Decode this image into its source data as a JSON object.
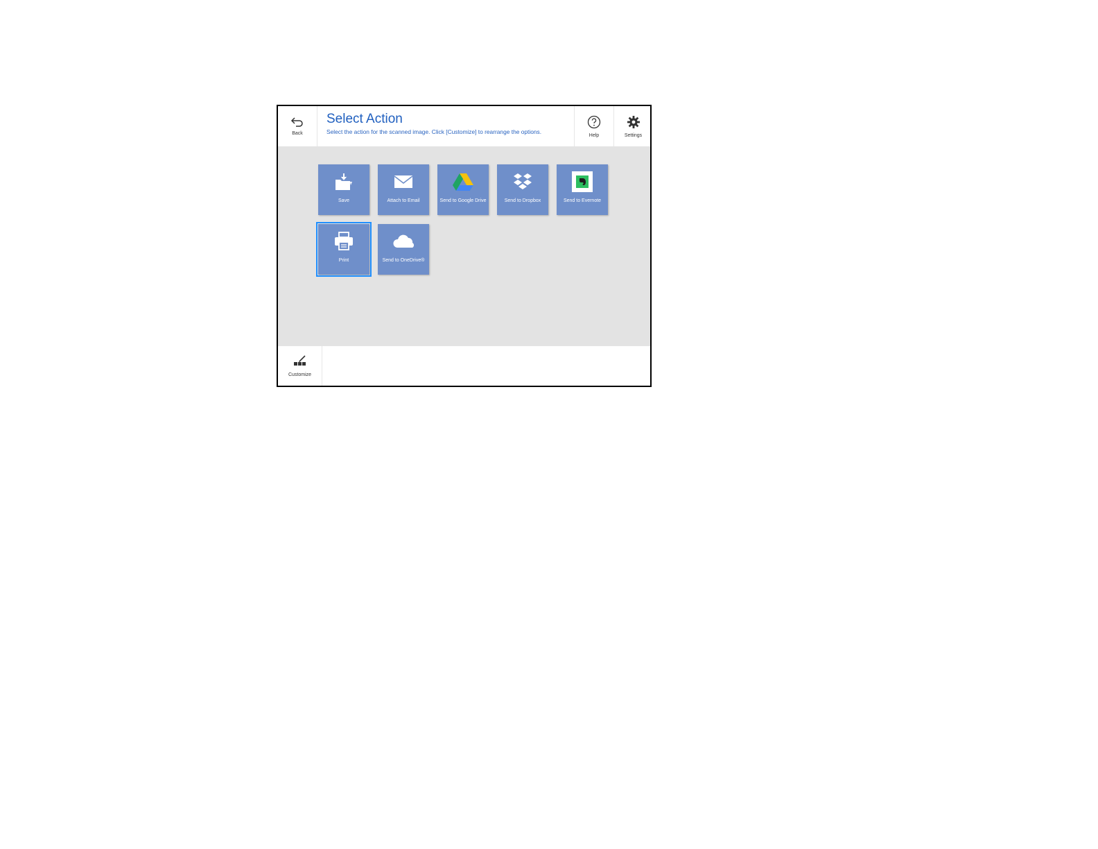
{
  "header": {
    "back_label": "Back",
    "title": "Select Action",
    "subtitle": "Select the action for the scanned image. Click [Customize] to rearrange the options.",
    "help_label": "Help",
    "settings_label": "Settings"
  },
  "actions": [
    {
      "label": "Save",
      "icon": "save-folder-icon"
    },
    {
      "label": "Attach to Email",
      "icon": "envelope-icon"
    },
    {
      "label": "Send to Google Drive",
      "icon": "google-drive-icon"
    },
    {
      "label": "Send to Dropbox",
      "icon": "dropbox-icon"
    },
    {
      "label": "Send to Evernote",
      "icon": "evernote-icon"
    },
    {
      "label": "Print",
      "icon": "printer-icon",
      "selected": true
    },
    {
      "label": "Send to OneDrive®",
      "icon": "onedrive-cloud-icon"
    }
  ],
  "footer": {
    "customize_label": "Customize"
  },
  "colors": {
    "tile": "#6f8fca",
    "title": "#1f5fbf",
    "content_bg": "#e3e3e3",
    "selected_outline": "#1f8fff"
  }
}
